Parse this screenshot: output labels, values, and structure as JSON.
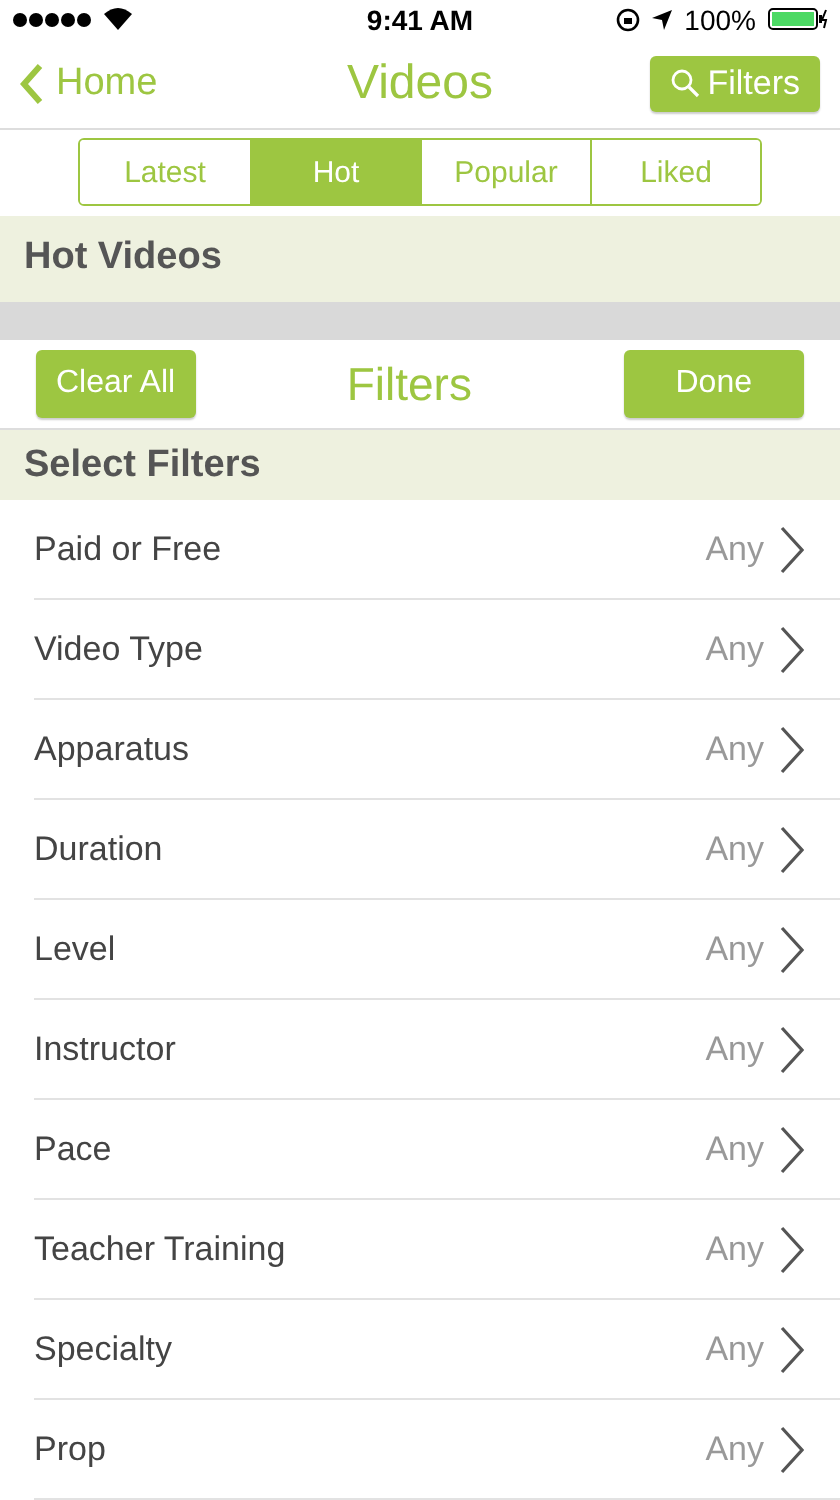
{
  "status_bar": {
    "time": "9:41 AM",
    "battery": "100%"
  },
  "nav": {
    "back": "Home",
    "title": "Videos",
    "action": "Filters"
  },
  "tabs": [
    {
      "label": "Latest",
      "selected": false
    },
    {
      "label": "Hot",
      "selected": true
    },
    {
      "label": "Popular",
      "selected": false
    },
    {
      "label": "Liked",
      "selected": false
    }
  ],
  "section_title": "Hot Videos",
  "filter_bar": {
    "clear": "Clear All",
    "title": "Filters",
    "done": "Done"
  },
  "filters_header": "Select Filters",
  "filters": [
    {
      "label": "Paid or Free",
      "value": "Any"
    },
    {
      "label": "Video Type",
      "value": "Any"
    },
    {
      "label": "Apparatus",
      "value": "Any"
    },
    {
      "label": "Duration",
      "value": "Any"
    },
    {
      "label": "Level",
      "value": "Any"
    },
    {
      "label": "Instructor",
      "value": "Any"
    },
    {
      "label": "Pace",
      "value": "Any"
    },
    {
      "label": "Teacher Training",
      "value": "Any"
    },
    {
      "label": "Specialty",
      "value": "Any"
    },
    {
      "label": "Prop",
      "value": "Any"
    }
  ]
}
